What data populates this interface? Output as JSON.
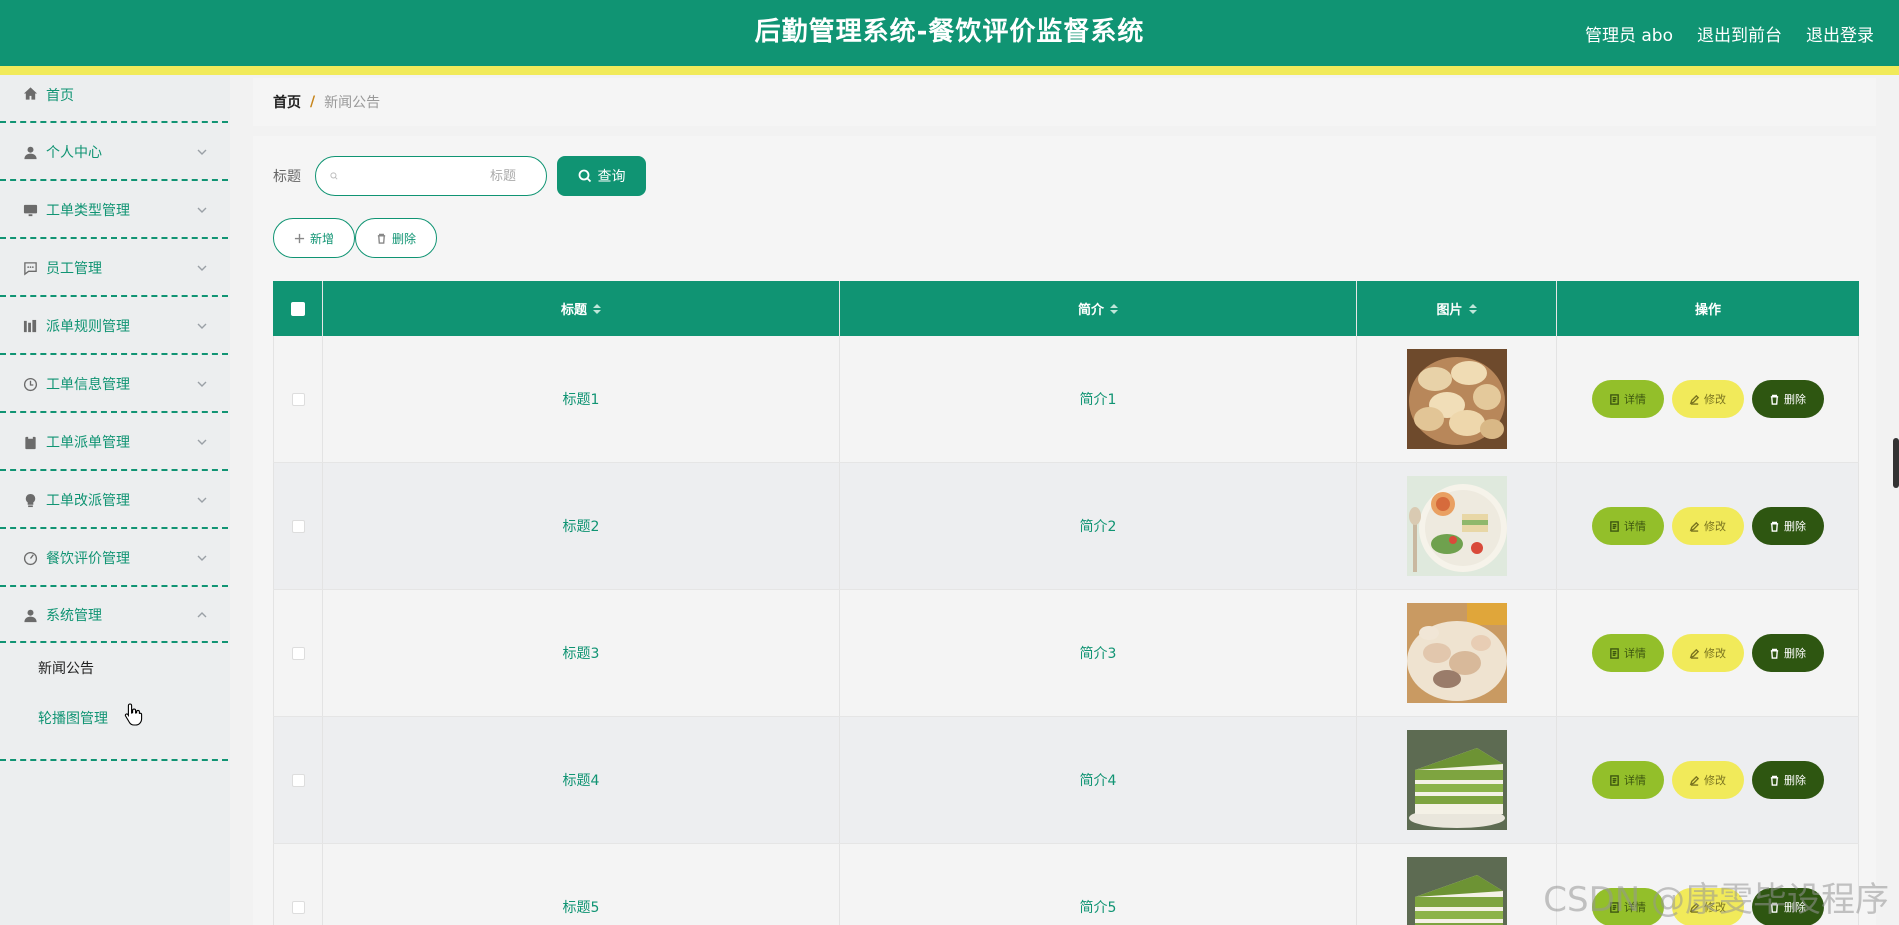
{
  "header": {
    "title": "后勤管理系统-餐饮评价监督系统",
    "user": "管理员 abo",
    "front_link": "退出到前台",
    "logout": "退出登录"
  },
  "sidebar": {
    "items": [
      {
        "label": "首页",
        "icon": "home-icon"
      },
      {
        "label": "个人中心",
        "icon": "user-icon"
      },
      {
        "label": "工单类型管理",
        "icon": "monitor-icon"
      },
      {
        "label": "员工管理",
        "icon": "chat-icon"
      },
      {
        "label": "派单规则管理",
        "icon": "chart-icon"
      },
      {
        "label": "工单信息管理",
        "icon": "clock-icon"
      },
      {
        "label": "工单派单管理",
        "icon": "clipboard-icon"
      },
      {
        "label": "工单改派管理",
        "icon": "bulb-icon"
      },
      {
        "label": "餐饮评价管理",
        "icon": "gauge-icon"
      },
      {
        "label": "系统管理",
        "icon": "user-icon"
      }
    ],
    "sub_items": [
      "新闻公告",
      "轮播图管理"
    ]
  },
  "breadcrumb": {
    "home": "首页",
    "separator": "/",
    "current": "新闻公告"
  },
  "search": {
    "label": "标题",
    "placeholder": "标题",
    "button": "查询"
  },
  "actions": {
    "add": "新增",
    "delete": "删除"
  },
  "table": {
    "columns": [
      "标题",
      "简介",
      "图片",
      "操作"
    ],
    "rows": [
      {
        "title": "标题1",
        "brief": "简介1"
      },
      {
        "title": "标题2",
        "brief": "简介2"
      },
      {
        "title": "标题3",
        "brief": "简介3"
      },
      {
        "title": "标题4",
        "brief": "简介4"
      },
      {
        "title": "标题5",
        "brief": "简介5"
      }
    ],
    "op_labels": {
      "detail": "详情",
      "edit": "修改",
      "delete": "删除"
    }
  },
  "watermark": "CSDN @康雯毕设程序",
  "colors": {
    "primary": "#109473",
    "accent_yellow": "#f1ea5a",
    "detail_green": "#93bf2a",
    "delete_dark": "#2e5611"
  }
}
